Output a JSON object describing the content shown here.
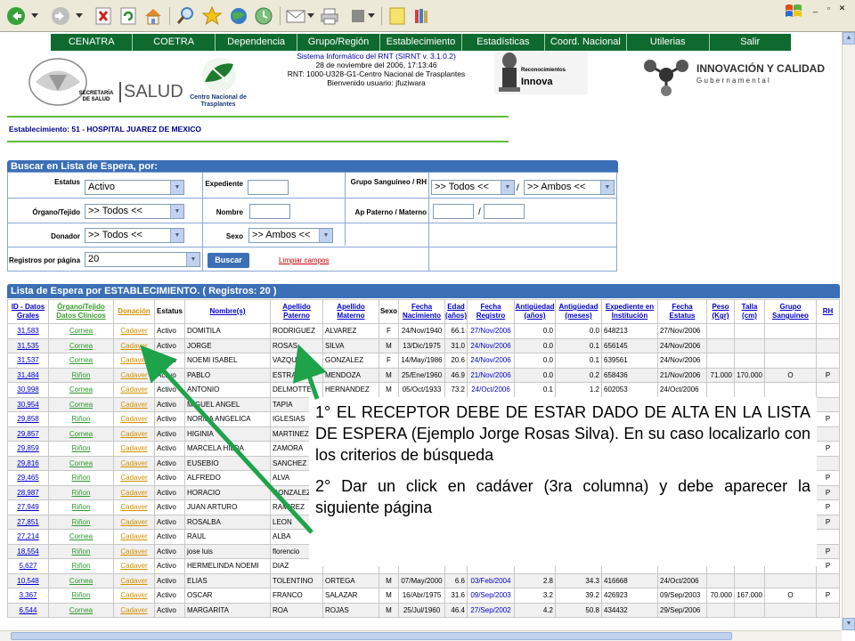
{
  "toolbar": {
    "icons": [
      "back-icon",
      "forward-icon",
      "stop-icon",
      "refresh-icon",
      "home-icon",
      "search-icon",
      "favorites-icon",
      "media-icon",
      "history-icon",
      "mail-icon",
      "print-icon",
      "edit-icon",
      "notes-icon",
      "research-icon"
    ]
  },
  "window": {
    "min": "_",
    "restore": "▫",
    "close": "✕"
  },
  "menu": [
    "CENATRA",
    "COETRA",
    "Dependencia",
    "Grupo/Región",
    "Establecimiento",
    "Estadísticas",
    "Coord. Nacional",
    "Utilerias",
    "Salir"
  ],
  "header": {
    "sys_line1": "Sistema Informático del RNT (SIRNT v. 3.1.0.2)",
    "sys_line2": "28 de noviembre del 2006, 17:13:46",
    "sys_line3": "RNT: 1000-U328-G1-Centro Nacional de Trasplantes",
    "sys_line4": "Bienvenido usuario: jfuziwara",
    "secretaria": "SECRETARÍA DE SALUD",
    "salud": "SALUD",
    "cenatra": "Centro Nacional de Trasplantes",
    "reconocimientos": "Reconocimientos",
    "innova": "Innova",
    "innovacion": "INNOVACIÓN Y CALIDAD",
    "gubernamental": "G u b e r n a m e n t a l"
  },
  "establecimiento": "Establecimiento: 51 - HOSPITAL JUAREZ DE MEXICO",
  "search": {
    "title": "Buscar en Lista de Espera, por:",
    "estatus_label": "Estatus",
    "estatus_value": "Activo",
    "organo_label": "Órgano/Tejido",
    "organo_value": ">> Todos <<",
    "donador_label": "Donador",
    "donador_value": ">> Todos <<",
    "registros_label": "Registros por página",
    "registros_value": "20",
    "expediente_label": "Expediente",
    "nombre_label": "Nombre",
    "sexo_label": "Sexo",
    "sexo_value": ">> Ambos <<",
    "grupo_label": "Grupo Sanguineo / RH",
    "grupo_value": ">> Todos <<",
    "rh_value": ">> Ambos <<",
    "apellido_label": "Ap Paterno / Materno",
    "slash": "/",
    "buscar": "Buscar",
    "limpiar": "Limpiar campos"
  },
  "list": {
    "title": "Lista de Espera por ESTABLECIMIENTO.  ( Registros: 20 )"
  },
  "columns": [
    "ID - Datos Grales",
    "Órgano/Tejido Datos Clínicos",
    "Donación",
    "Estatus",
    "Nombre(s)",
    "Apellido Paterno",
    "Apellido Materno",
    "Sexo",
    "Fecha Nacimiento",
    "Edad (años)",
    "Fecha Registro",
    "Antigüedad (años)",
    "Antigüedad (meses)",
    "Expediente en Institución",
    "Fecha Estatus",
    "Peso (Kgr)",
    "Talla (cm)",
    "Grupo Sanguineo",
    "RH"
  ],
  "rows": [
    [
      "31,583",
      "Cornea",
      "Cadaver",
      "Activo",
      "DOMITILA",
      "RODRIGUEZ",
      "ALVAREZ",
      "F",
      "24/Nov/1940",
      "66.1",
      "27/Nov/2006",
      "0.0",
      "0.0",
      "648213",
      "27/Nov/2006",
      "",
      "",
      "",
      ""
    ],
    [
      "31,535",
      "Cornea",
      "Cadaver",
      "Activo",
      "JORGE",
      "ROSAS",
      "SILVA",
      "M",
      "13/Dic/1975",
      "31.0",
      "24/Nov/2006",
      "0.0",
      "0.1",
      "656145",
      "24/Nov/2006",
      "",
      "",
      "",
      ""
    ],
    [
      "31,537",
      "Cornea",
      "Cadaver",
      "Activo",
      "NOEMI ISABEL",
      "VAZQUEZ",
      "GONZALEZ",
      "F",
      "14/May/1986",
      "20.6",
      "24/Nov/2006",
      "0.0",
      "0.1",
      "639561",
      "24/Nov/2006",
      "",
      "",
      "",
      ""
    ],
    [
      "31,484",
      "Riñon",
      "Cadaver",
      "Activo",
      "PABLO",
      "ESTRADA",
      "MENDOZA",
      "M",
      "25/Ene/1960",
      "46.9",
      "21/Nov/2006",
      "0.0",
      "0.2",
      "658436",
      "21/Nov/2006",
      "71.000",
      "170.000",
      "O",
      "P"
    ],
    [
      "30,998",
      "Cornea",
      "Cadaver",
      "Activo",
      "ANTONIO",
      "DELMOTTE",
      "HERNANDEZ",
      "M",
      "05/Oct/1933",
      "73.2",
      "24/Oct/2006",
      "0.1",
      "1.2",
      "602053",
      "24/Oct/2006",
      "",
      "",
      "",
      ""
    ],
    [
      "30,954",
      "Cornea",
      "Cadaver",
      "Activo",
      "MIGUEL ANGEL",
      "TAPIA",
      "",
      "",
      "",
      "",
      "",
      "",
      "",
      "",
      "",
      "",
      "",
      "",
      ""
    ],
    [
      "29,858",
      "Riñon",
      "Cadaver",
      "Activo",
      "NORMA ANGELICA",
      "IGLESIAS",
      "",
      "",
      "",
      "",
      "",
      "",
      "",
      "",
      "",
      "",
      "",
      "",
      "P"
    ],
    [
      "29,857",
      "Cornea",
      "Cadaver",
      "Activo",
      "HIGINIA",
      "MARTINEZ",
      "",
      "",
      "",
      "",
      "",
      "",
      "",
      "",
      "",
      "",
      "",
      "",
      ""
    ],
    [
      "29,859",
      "Riñon",
      "Cadaver",
      "Activo",
      "MARCELA HILDA",
      "ZAMORA",
      "",
      "",
      "",
      "",
      "",
      "",
      "",
      "",
      "",
      "",
      "",
      "",
      "P"
    ],
    [
      "29,816",
      "Cornea",
      "Cadaver",
      "Activo",
      "EUSEBIO",
      "SANCHEZ",
      "",
      "",
      "",
      "",
      "",
      "",
      "",
      "",
      "",
      "",
      "",
      "",
      ""
    ],
    [
      "29,465",
      "Riñon",
      "Cadaver",
      "Activo",
      "ALFREDO",
      "ALVA",
      "",
      "",
      "",
      "",
      "",
      "",
      "",
      "",
      "",
      "",
      "",
      "",
      "P"
    ],
    [
      "28,987",
      "Riñon",
      "Cadaver",
      "Activo",
      "HORACIO",
      "GONZALEZ",
      "",
      "",
      "",
      "",
      "",
      "",
      "",
      "",
      "",
      "",
      "",
      "",
      "P"
    ],
    [
      "27,949",
      "Riñon",
      "Cadaver",
      "Activo",
      "JUAN ARTURO",
      "RAMIREZ",
      "",
      "",
      "",
      "",
      "",
      "",
      "",
      "",
      "",
      "",
      "",
      "",
      "P"
    ],
    [
      "27,851",
      "Riñon",
      "Cadaver",
      "Activo",
      "ROSALBA",
      "LEON",
      "",
      "",
      "",
      "",
      "",
      "",
      "",
      "",
      "",
      "",
      "",
      "",
      "P"
    ],
    [
      "27,214",
      "Cornea",
      "Cadaver",
      "Activo",
      "RAUL",
      "ALBA",
      "",
      "",
      "",
      "",
      "",
      "",
      "",
      "",
      "",
      "",
      "",
      "",
      ""
    ],
    [
      "18,554",
      "Riñon",
      "Cadaver",
      "Activo",
      "jose luis",
      "florencio",
      "",
      "",
      "",
      "",
      "",
      "",
      "",
      "",
      "",
      "",
      "",
      "",
      "P"
    ],
    [
      "5,627",
      "Riñon",
      "Cadaver",
      "Activo",
      "HERMELINDA NOEMI",
      "DIAZ",
      "",
      "",
      "",
      "",
      "",
      "",
      "",
      "",
      "",
      "",
      "",
      "",
      "P"
    ],
    [
      "10,548",
      "Cornea",
      "Cadaver",
      "Activo",
      "ELIAS",
      "TOLENTINO",
      "ORTEGA",
      "M",
      "07/May/2000",
      "6.6",
      "03/Feb/2004",
      "2.8",
      "34.3",
      "416668",
      "24/Oct/2006",
      "",
      "",
      "",
      ""
    ],
    [
      "3,367",
      "Riñon",
      "Cadaver",
      "Activo",
      "OSCAR",
      "FRANCO",
      "SALAZAR",
      "M",
      "16/Abr/1975",
      "31.6",
      "09/Sep/2003",
      "3.2",
      "39.2",
      "426923",
      "09/Sep/2003",
      "70.000",
      "167.000",
      "O",
      "P"
    ],
    [
      "6,544",
      "Cornea",
      "Cadaver",
      "Activo",
      "MARGARITA",
      "ROA",
      "ROJAS",
      "M",
      "25/Jul/1960",
      "46.4",
      "27/Sep/2002",
      "4.2",
      "50.8",
      "434432",
      "29/Sep/2006",
      "",
      "",
      "",
      ""
    ]
  ],
  "note": {
    "p1": "1° EL RECEPTOR DEBE DE ESTAR DADO DE ALTA EN LA LISTA DE ESPERA (Ejemplo Jorge Rosas Silva). En su caso localizarlo con los criterios de búsqueda",
    "p2": "2° Dar un click en cadáver (3ra columna) y debe aparecer la siguiente página"
  },
  "colors": {
    "menu_green": "#0f6a2f",
    "panel_blue": "#3b6fb6",
    "arrow_green": "#1fa34a",
    "link_blue": "#0000cc",
    "organ_green": "#2d9a2d",
    "donation_orange": "#d49000"
  }
}
